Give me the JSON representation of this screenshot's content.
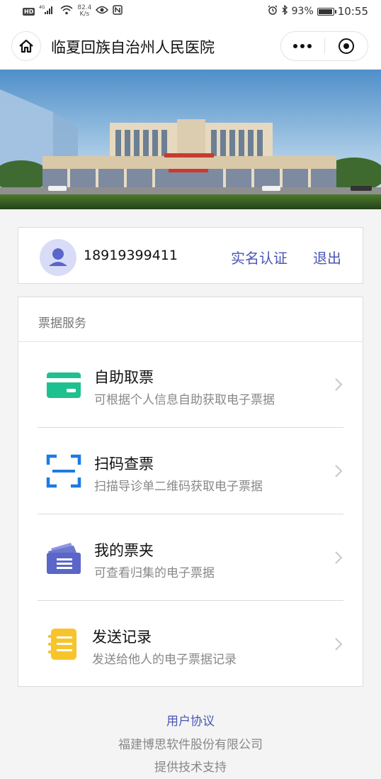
{
  "status_bar": {
    "network": "4G",
    "speed_value": "82.4",
    "speed_unit": "K/s",
    "battery": "93%",
    "time": "10:55",
    "icons": [
      "hd-icon",
      "signal-icon",
      "wifi-icon",
      "eye-icon",
      "nfc-icon",
      "alarm-icon",
      "bluetooth-icon",
      "battery-icon"
    ]
  },
  "nav": {
    "title": "临夏回族自治州人民医院",
    "home_icon": "home-icon",
    "more_icon": "more-icon",
    "close_icon": "close-miniprogram-icon"
  },
  "user": {
    "phone": "18919399411",
    "verify_label": "实名认证",
    "logout_label": "退出"
  },
  "services": {
    "section_title": "票据服务",
    "items": [
      {
        "name": "自助取票",
        "desc": "可根据个人信息自助获取电子票据",
        "icon": "card-icon",
        "color": "#1fc08f"
      },
      {
        "name": "扫码查票",
        "desc": "扫描导诊单二维码获取电子票据",
        "icon": "scan-icon",
        "color": "#1e7be0"
      },
      {
        "name": "我的票夹",
        "desc": "可查看归集的电子票据",
        "icon": "ticket-folder-icon",
        "color": "#5a66c8"
      },
      {
        "name": "发送记录",
        "desc": "发送给他人的电子票据记录",
        "icon": "send-record-icon",
        "color": "#f7c52b"
      }
    ]
  },
  "footer": {
    "agreement": "用户协议",
    "company": "福建博思软件股份有限公司",
    "support": "提供技术支持"
  },
  "colors": {
    "accent": "#4a55b4",
    "background": "#f4f4f4"
  }
}
